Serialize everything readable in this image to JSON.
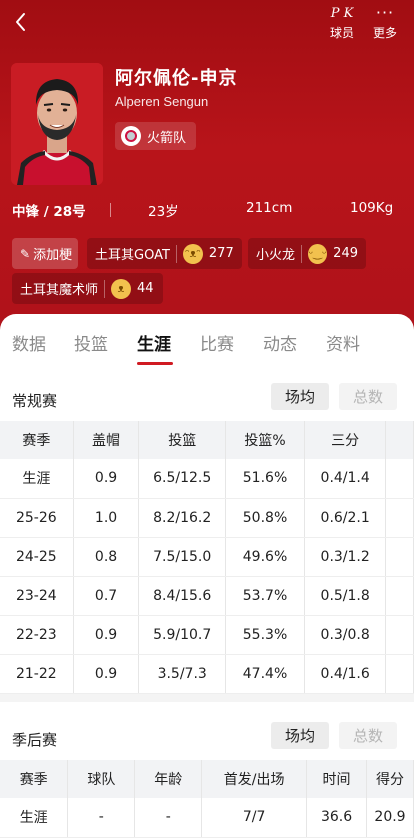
{
  "header": {
    "back_icon": "chevron-left-icon",
    "pk_label": "球员",
    "pk_icon": "P K",
    "more_label": "更多",
    "more_icon": "···",
    "colors": {
      "hero_red": "#b8141a",
      "accent": "#d01a22"
    }
  },
  "player": {
    "name_cn": "阿尔佩伦-申京",
    "name_en": "Alperen Sengun",
    "team": "火箭队",
    "position_number": "中锋 / 28号",
    "age": "23岁",
    "height": "211cm",
    "weight": "109Kg"
  },
  "tags": {
    "add_label": "添加梗",
    "items": [
      {
        "label": "土耳其GOAT",
        "count": "277",
        "emoji_icon": "laughing-face-icon"
      },
      {
        "label": "小火龙",
        "count": "249",
        "emoji_icon": "grin-face-icon"
      },
      {
        "label": "土耳其魔术师",
        "count": "44",
        "emoji_icon": "lion-face-icon"
      }
    ]
  },
  "tabs": [
    "数据",
    "投篮",
    "生涯",
    "比赛",
    "动态",
    "资料"
  ],
  "active_tab": "生涯",
  "regular": {
    "title": "常规赛",
    "seg_avg": "场均",
    "seg_total": "总数",
    "columns": [
      "赛季",
      "盖帽",
      "投篮",
      "投篮%",
      "三分"
    ],
    "rows": [
      [
        "生涯",
        "0.9",
        "6.5/12.5",
        "51.6%",
        "0.4/1.4"
      ],
      [
        "25-26",
        "1.0",
        "8.2/16.2",
        "50.8%",
        "0.6/2.1"
      ],
      [
        "24-25",
        "0.8",
        "7.5/15.0",
        "49.6%",
        "0.3/1.2"
      ],
      [
        "23-24",
        "0.7",
        "8.4/15.6",
        "53.7%",
        "0.5/1.8"
      ],
      [
        "22-23",
        "0.9",
        "5.9/10.7",
        "55.3%",
        "0.3/0.8"
      ],
      [
        "21-22",
        "0.9",
        "3.5/7.3",
        "47.4%",
        "0.4/1.6"
      ]
    ]
  },
  "playoffs": {
    "title": "季后赛",
    "seg_avg": "场均",
    "seg_total": "总数",
    "columns": [
      "赛季",
      "球队",
      "年龄",
      "首发/出场",
      "时间",
      "得分"
    ],
    "rows": [
      [
        "生涯",
        "-",
        "-",
        "7/7",
        "36.6",
        "20.9"
      ]
    ]
  }
}
